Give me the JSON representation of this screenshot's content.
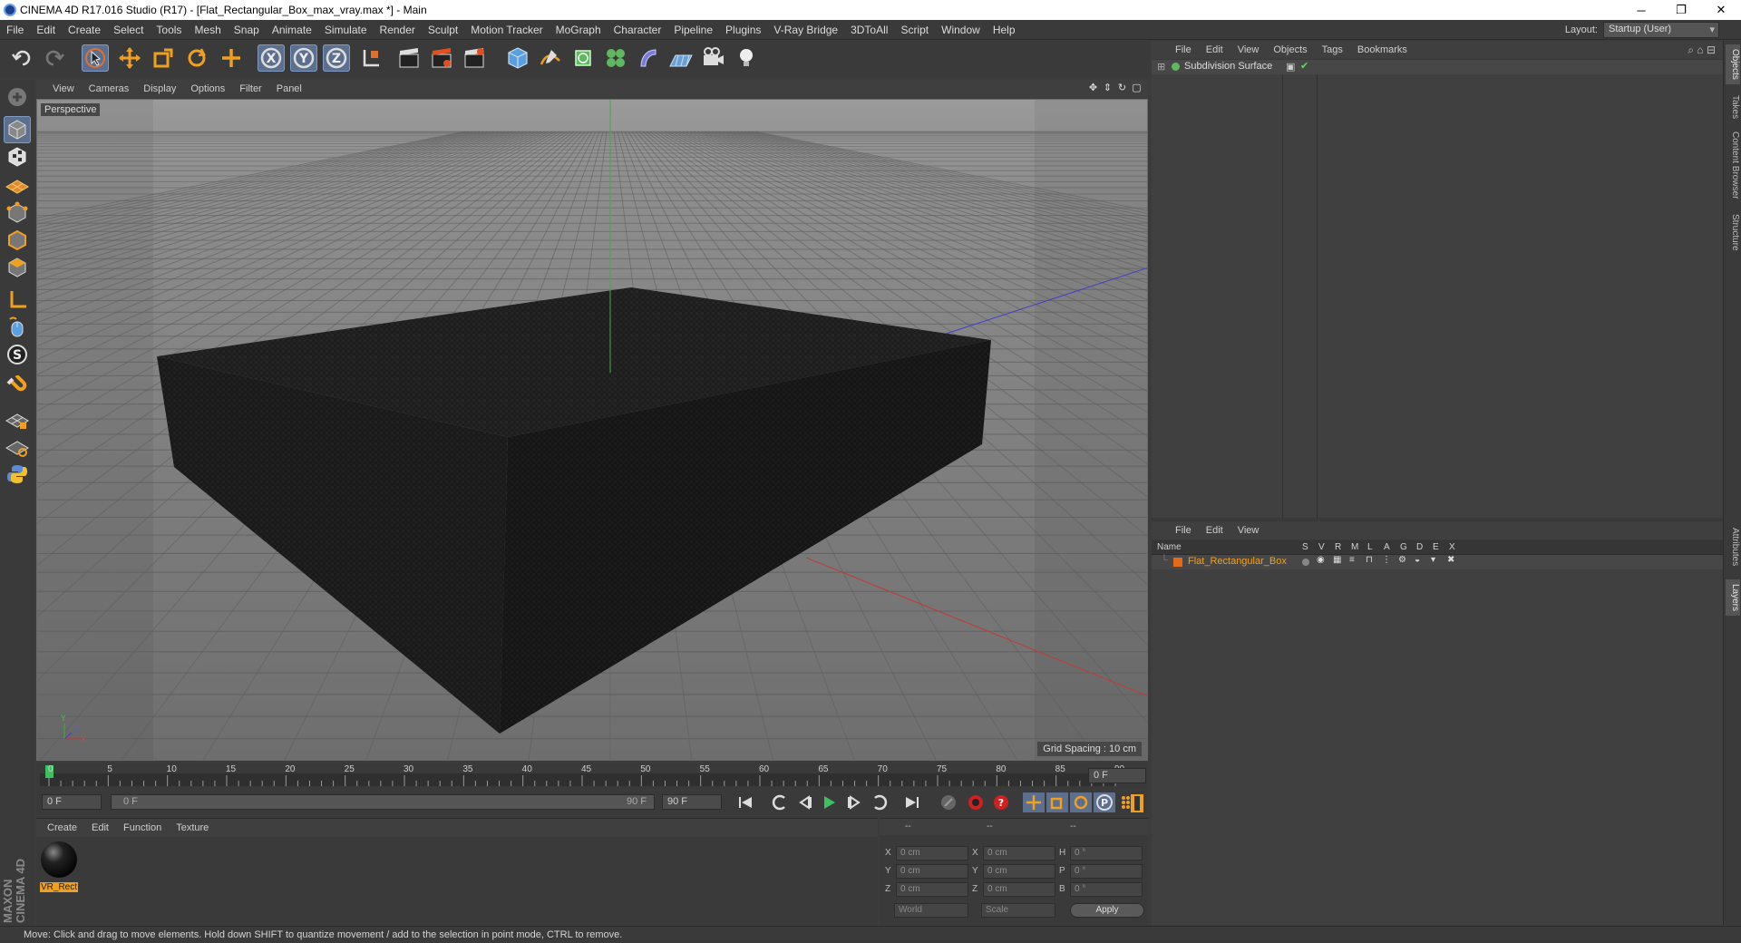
{
  "window": {
    "title": "CINEMA 4D R17.016 Studio (R17) - [Flat_Rectangular_Box_max_vray.max *] - Main",
    "minimize": "─",
    "maximize": "❐",
    "close": "✕"
  },
  "menubar": {
    "items": [
      "File",
      "Edit",
      "Create",
      "Select",
      "Tools",
      "Mesh",
      "Snap",
      "Animate",
      "Simulate",
      "Render",
      "Sculpt",
      "Motion Tracker",
      "MoGraph",
      "Character",
      "Pipeline",
      "Plugins",
      "V-Ray Bridge",
      "3DToAll",
      "Script",
      "Window",
      "Help"
    ],
    "layout_label": "Layout:",
    "layout_value": "Startup (User)"
  },
  "viewport": {
    "menu": [
      "View",
      "Cameras",
      "Display",
      "Options",
      "Filter",
      "Panel"
    ],
    "camera_label": "Perspective",
    "grid_spacing": "Grid Spacing : 10 cm",
    "axis_x": "X",
    "axis_y": "Y",
    "axis_z": "Z"
  },
  "timeline": {
    "ticks": [
      "0",
      "5",
      "10",
      "15",
      "20",
      "25",
      "30",
      "35",
      "40",
      "45",
      "50",
      "55",
      "60",
      "65",
      "70",
      "75",
      "80",
      "85",
      "90"
    ],
    "current_frame": "0 F"
  },
  "transport": {
    "start_frame": "0 F",
    "range_start": "0 F",
    "range_end": "90 F",
    "end_frame": "90 F"
  },
  "materials": {
    "menu": [
      "Create",
      "Edit",
      "Function",
      "Texture"
    ],
    "items": [
      {
        "name": "VR_Rect"
      }
    ]
  },
  "coordinates": {
    "headers": [
      "--",
      "--",
      "--"
    ],
    "rows": [
      {
        "l1": "X",
        "v1": "0 cm",
        "l2": "X",
        "v2": "0 cm",
        "l3": "H",
        "v3": "0 °"
      },
      {
        "l1": "Y",
        "v1": "0 cm",
        "l2": "Y",
        "v2": "0 cm",
        "l3": "P",
        "v3": "0 °"
      },
      {
        "l1": "Z",
        "v1": "0 cm",
        "l2": "Z",
        "v2": "0 cm",
        "l3": "B",
        "v3": "0 °"
      }
    ],
    "mode": "World",
    "transform": "Scale",
    "apply": "Apply"
  },
  "objects": {
    "menu": [
      "File",
      "Edit",
      "View",
      "Objects",
      "Tags",
      "Bookmarks"
    ],
    "items": [
      {
        "name": "Subdivision Surface"
      }
    ]
  },
  "layers": {
    "menu": [
      "File",
      "Edit",
      "View"
    ],
    "name_header": "Name",
    "columns": [
      "S",
      "V",
      "R",
      "M",
      "L",
      "A",
      "G",
      "D",
      "E",
      "X"
    ],
    "items": [
      {
        "name": "Flat_Rectangular_Box",
        "color": "#e26a1a"
      }
    ]
  },
  "sidetabs": [
    "Objects",
    "Takes",
    "Content Browser",
    "Structure",
    "Attributes",
    "Layers"
  ],
  "status": "Move: Click and drag to move elements. Hold down SHIFT to quantize movement / add to the selection in point mode, CTRL to remove.",
  "brand": "MAXON CINEMA 4D",
  "colors": {
    "accent": "#5c6f8e",
    "layer_orange": "#e26a1a",
    "axis_green": "#3fae3f",
    "axis_red": "#c23a3a",
    "axis_blue": "#4040c8"
  }
}
